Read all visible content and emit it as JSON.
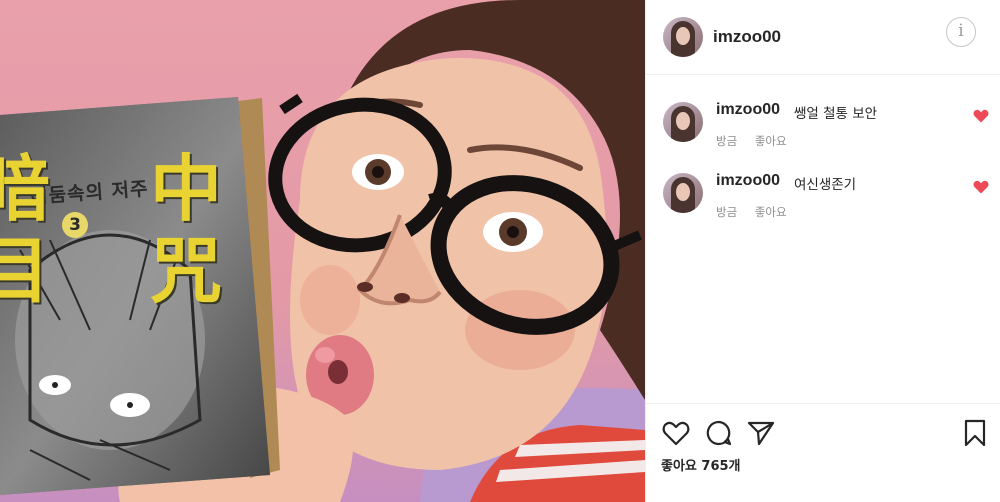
{
  "photo": {
    "book_subtitle": "어둠속의 저주",
    "book_volume": "3",
    "book_kanji_right": "中\n咒",
    "book_kanji_left": "暗\n目"
  },
  "header": {
    "username": "imzoo00",
    "info_icon_glyph": "i"
  },
  "comments": [
    {
      "username": "imzoo00",
      "text": "쌩얼 철통 보안",
      "time": "방금",
      "like_label": "좋아요"
    },
    {
      "username": "imzoo00",
      "text": "여신생존기",
      "time": "방금",
      "like_label": "좋아요"
    }
  ],
  "actions": {
    "likes_text": "좋아요 765개"
  },
  "colors": {
    "heart": "#ed4956",
    "background_pink": "#e9a0ab",
    "icon_stroke": "#262626"
  }
}
